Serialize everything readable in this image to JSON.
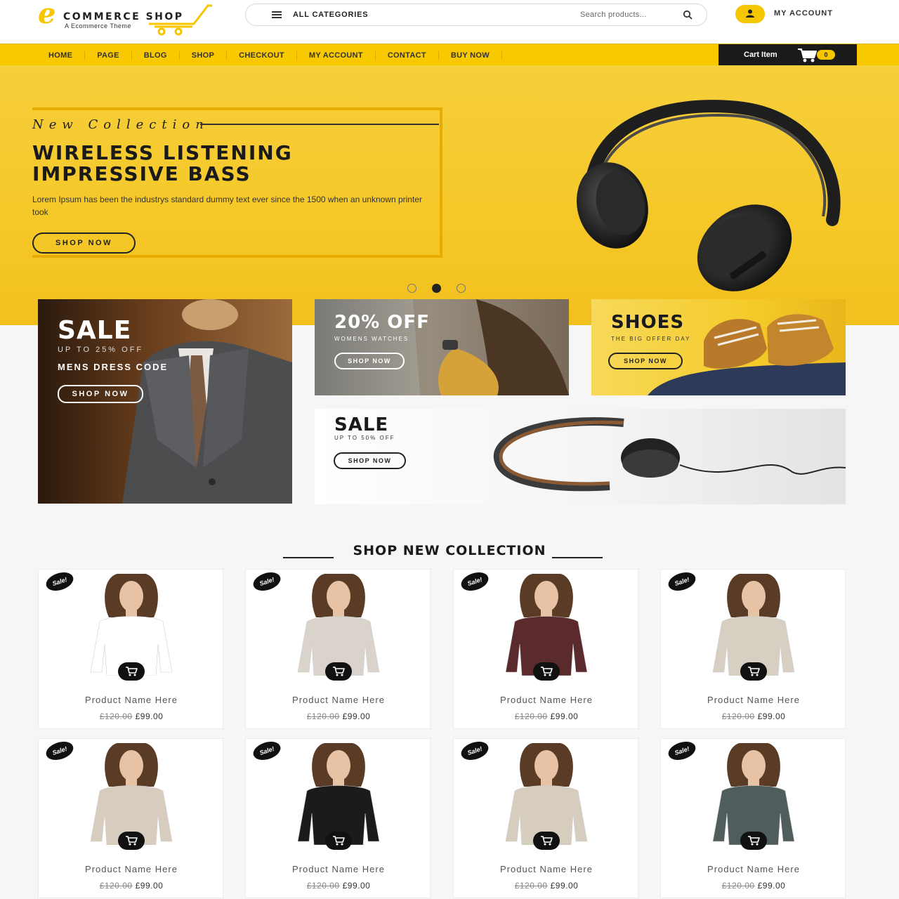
{
  "header": {
    "logo_text": "COMMERCE SHOP",
    "logo_letter": "e",
    "logo_tagline": "A Ecommerce Theme",
    "categories_label": "ALL CATEGORIES",
    "search_placeholder": "Search products...",
    "account_label": "MY ACCOUNT"
  },
  "nav": {
    "items": [
      "HOME",
      "PAGE",
      "BLOG",
      "SHOP",
      "CHECKOUT",
      "MY ACCOUNT",
      "CONTACT",
      "BUY NOW"
    ],
    "cart_label": "Cart Item",
    "cart_count": "0"
  },
  "hero": {
    "kicker": "New Collection",
    "title_line1": "WIRELESS LISTENING",
    "title_line2": "IMPRESSIVE BASS",
    "description": "Lorem Ipsum has been the industrys standard dummy text ever since the 1500 when an unknown printer took",
    "button": "SHOP NOW",
    "slides": 3,
    "active_slide": 2
  },
  "banners": {
    "suit": {
      "title": "SALE",
      "subtitle": "UP TO 25% OFF",
      "tagline": "MENS DRESS CODE",
      "button": "SHOP NOW"
    },
    "watch": {
      "title": "20% OFF",
      "subtitle": "WOMENS WATCHES",
      "button": "SHOP NOW"
    },
    "shoes": {
      "title": "SHOES",
      "subtitle": "THE BIG OFFER DAY",
      "button": "SHOP NOW"
    },
    "wide": {
      "title": "SALE",
      "subtitle": "UP TO 50% OFF",
      "button": "SHOP NOW"
    }
  },
  "section": {
    "title": "SHOP NEW COLLECTION"
  },
  "products": [
    {
      "name": "Product Name Here",
      "old_price": "£120.00",
      "price": "£99.00",
      "badge": "Sale!",
      "top": "#ffffff"
    },
    {
      "name": "Product Name Here",
      "old_price": "£120.00",
      "price": "£99.00",
      "badge": "Sale!",
      "top": "#d9d3cb"
    },
    {
      "name": "Product Name Here",
      "old_price": "£120.00",
      "price": "£99.00",
      "badge": "Sale!",
      "top": "#5a2a2c"
    },
    {
      "name": "Product Name Here",
      "old_price": "£120.00",
      "price": "£99.00",
      "badge": "Sale!",
      "top": "#d8cfc3"
    },
    {
      "name": "Product Name Here",
      "old_price": "£120.00",
      "price": "£99.00",
      "badge": "Sale!",
      "top": "#d8ccbe"
    },
    {
      "name": "Product Name Here",
      "old_price": "£120.00",
      "price": "£99.00",
      "badge": "Sale!",
      "top": "#1b1b1d"
    },
    {
      "name": "Product Name Here",
      "old_price": "£120.00",
      "price": "£99.00",
      "badge": "Sale!",
      "top": "#d6cdbf"
    },
    {
      "name": "Product Name Here",
      "old_price": "£120.00",
      "price": "£99.00",
      "badge": "Sale!",
      "top": "#4f5d5c"
    }
  ],
  "colors": {
    "accent": "#f9c900",
    "dark": "#1a1a1a"
  }
}
